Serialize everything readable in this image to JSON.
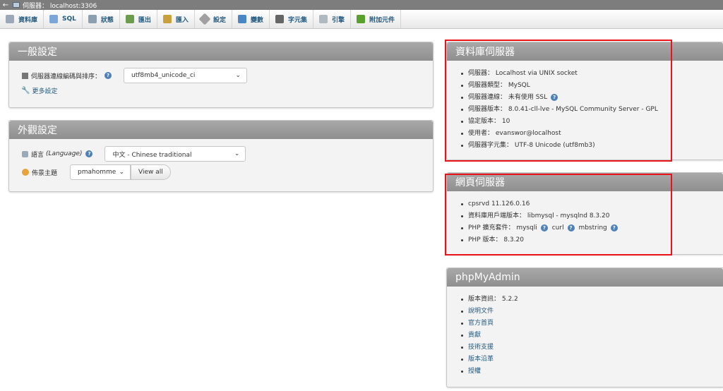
{
  "window": {
    "title": "伺服器： localhost:3306"
  },
  "tabs": [
    {
      "label": "資料庫",
      "icon": "database-icon"
    },
    {
      "label": "SQL",
      "icon": "sql-icon"
    },
    {
      "label": "狀態",
      "icon": "status-icon"
    },
    {
      "label": "匯出",
      "icon": "export-icon"
    },
    {
      "label": "匯入",
      "icon": "import-icon"
    },
    {
      "label": "設定",
      "icon": "wrench-icon"
    },
    {
      "label": "變數",
      "icon": "variables-icon"
    },
    {
      "label": "字元集",
      "icon": "charset-icon"
    },
    {
      "label": "引擎",
      "icon": "engine-icon"
    },
    {
      "label": "附加元件",
      "icon": "plugin-icon"
    }
  ],
  "general": {
    "title": "一般設定",
    "collation_label": "伺服器連線編碼與排序：",
    "collation_value": "utf8mb4_unicode_ci",
    "more_settings": "更多設定"
  },
  "appearance": {
    "title": "外觀設定",
    "language_label": "語言",
    "language_label_en": "(Language)",
    "language_value": "中文 - Chinese traditional",
    "theme_label": "佈景主題",
    "theme_value": "pmahomme",
    "view_all": "View all"
  },
  "db_server": {
    "title": "資料庫伺服器",
    "items": [
      "伺服器： Localhost via UNIX socket",
      "伺服器類型： MySQL",
      "伺服器連線： 未有使用 SSL",
      "伺服器版本： 8.0.41-cll-lve - MySQL Community Server - GPL",
      "協定版本： 10",
      "使用者： evanswor@localhost",
      "伺服器字元集： UTF-8 Unicode (utf8mb3)"
    ]
  },
  "web_server": {
    "title": "網頁伺服器",
    "items": [
      "cpsrvd 11.126.0.16",
      "資料庫用戶端版本： libmysql - mysqlnd 8.3.20",
      "PHP 擴充套件： mysqli",
      "PHP 版本： 8.3.20"
    ],
    "ext_curl": "curl",
    "ext_mbstring": "mbstring"
  },
  "pma": {
    "title": "phpMyAdmin",
    "version": "版本資訊： 5.2.2",
    "links": [
      "說明文件",
      "官方首頁",
      "貢獻",
      "技術支援",
      "版本沿革",
      "授權"
    ]
  },
  "colors": {
    "accent_link": "#235a81",
    "highlight": "#e8131b",
    "header_gray": "#9a9a9a"
  }
}
